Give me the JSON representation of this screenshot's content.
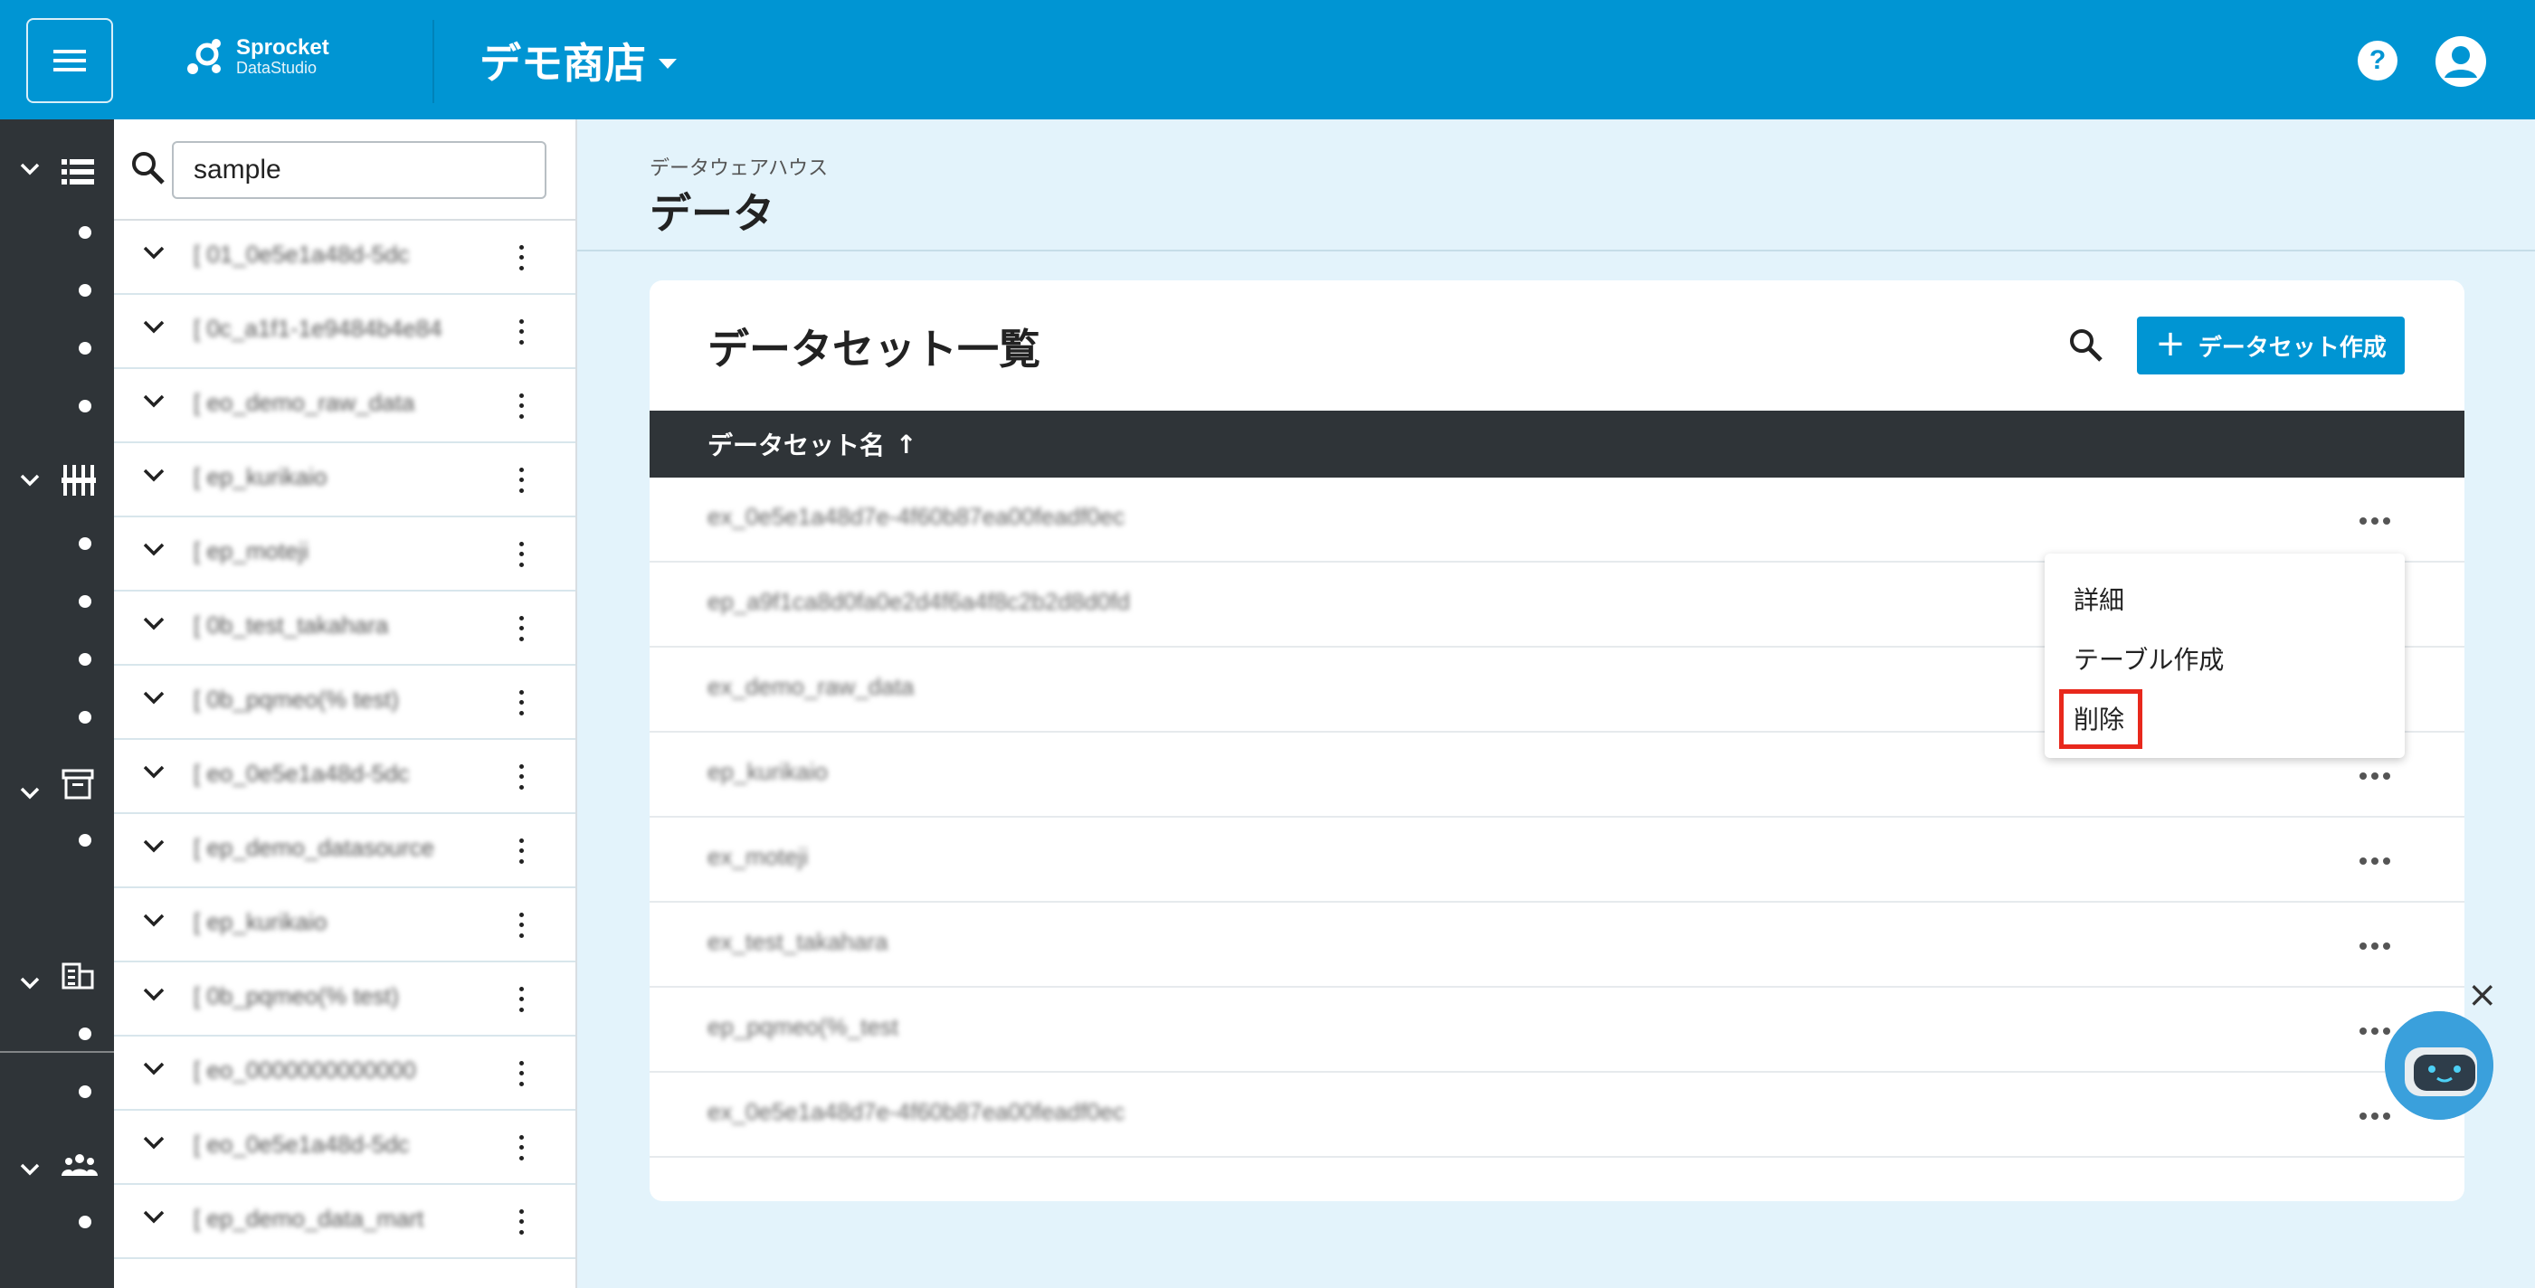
{
  "header": {
    "logo_name": "Sprocket",
    "logo_sub": "DataStudio",
    "shop_name": "デモ商店"
  },
  "tree": {
    "search_value": "sample",
    "items": [
      "[ 01_0e5e1a48d-5dc",
      "[ 0c_a1f1-1e9484b4e84",
      "[ eo_demo_raw_data",
      "[ ep_kurikaio",
      "[ ep_moteji",
      "[ 0b_test_takahara",
      "[ 0b_pqmeo(% test)",
      "[ eo_0e5e1a48d-5dc",
      "[ ep_demo_datasource",
      "[ ep_kurikaio",
      "[ 0b_pqmeo(% test)",
      "[ eo_0000000000000",
      "[ eo_0e5e1a48d-5dc",
      "[ ep_demo_data_mart"
    ]
  },
  "main": {
    "breadcrumb": "データウェアハウス",
    "title": "データ"
  },
  "card": {
    "title": "データセット一覧",
    "create_label": "データセット作成",
    "column_header": "データセット名",
    "sort_indicator": "↑",
    "rows": [
      "ex_0e5e1a48d7e-4f60b87ea00feadf0ec",
      "ep_a9f1ca8d0fa0e2d4f6a4f8c2b2d8d0fd",
      "ex_demo_raw_data",
      "ep_kurikaio",
      "ex_moteji",
      "ex_test_takahara",
      "ep_pqmeo(%_test",
      "ex_0e5e1a48d7e-4f60b87ea00feadf0ec"
    ]
  },
  "context_menu": {
    "items": [
      "詳細",
      "テーブル作成",
      "削除"
    ]
  },
  "colors": {
    "brand": "#0095d3",
    "rail": "#2f3438",
    "highlight": "#e8281c"
  }
}
